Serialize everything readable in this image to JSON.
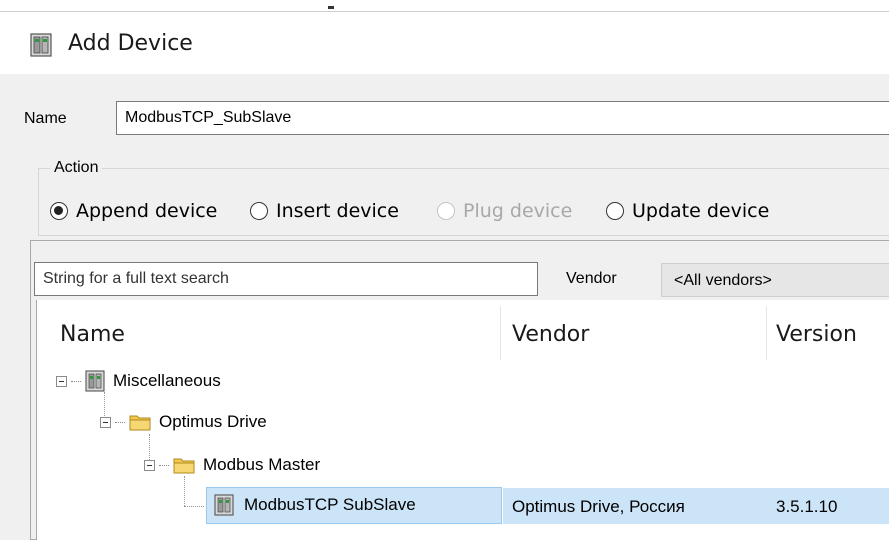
{
  "dialog": {
    "title": "Add Device"
  },
  "name_field": {
    "label": "Name",
    "value": "ModbusTCP_SubSlave"
  },
  "action": {
    "legend": "Action",
    "options": [
      {
        "label": "Append device",
        "checked": true,
        "enabled": true
      },
      {
        "label": "Insert device",
        "checked": false,
        "enabled": true
      },
      {
        "label": "Plug device",
        "checked": false,
        "enabled": false
      },
      {
        "label": "Update device",
        "checked": false,
        "enabled": true
      }
    ]
  },
  "search": {
    "placeholder": "String for a full text search"
  },
  "vendor_filter": {
    "label": "Vendor",
    "selected": "<All vendors>"
  },
  "tree": {
    "columns": [
      "Name",
      "Vendor",
      "Version"
    ],
    "nodes": [
      {
        "label": "Miscellaneous",
        "icon": "device-icon"
      },
      {
        "label": "Optimus Drive",
        "icon": "folder-icon"
      },
      {
        "label": "Modbus Master",
        "icon": "folder-icon"
      },
      {
        "label": "ModbusTCP SubSlave",
        "icon": "device-icon",
        "vendor": "Optimus Drive, Россия",
        "version": "3.5.1.10",
        "selected": true
      }
    ]
  },
  "colors": {
    "selection": "#cce4f7",
    "selection_border": "#99c9ef",
    "dialog_bg": "#f0f0f0"
  }
}
